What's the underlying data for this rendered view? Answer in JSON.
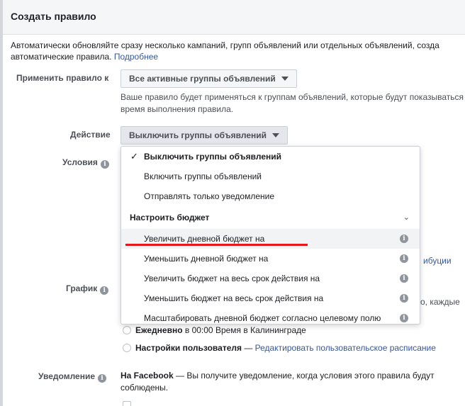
{
  "dialog": {
    "title": "Создать правило",
    "intro_line1": "Автоматически обновляйте сразу несколько кампаний, групп объявлений или отдельных объявлений, созда",
    "intro_line2": "автоматические правила.",
    "intro_link": "Подробнее"
  },
  "apply_rule": {
    "label": "Применить правило к",
    "value": "Все активные группы объявлений",
    "hint_line1": "Ваше правило будет применяться к группам объявлений, которые будут показываться",
    "hint_line2": "время выполнения правила."
  },
  "action": {
    "label": "Действие",
    "value": "Выключить группы объявлений"
  },
  "conditions": {
    "label": "Условия"
  },
  "schedule": {
    "label": "График"
  },
  "notification": {
    "label": "Уведомление",
    "facebook_bold": "На Facebook",
    "facebook_text": " — Вы получите уведомление, когда условия этого правила будут",
    "facebook_text2": "соблюдены."
  },
  "behind": {
    "attribution_fragment": "ибуции",
    "each_fragment": "о, каждые"
  },
  "schedule_options": [
    {
      "bold": "Ежедневно",
      "text": " в 00:00 Время в Калининграде",
      "link": ""
    },
    {
      "bold": "Настройки пользователя",
      "text": " — ",
      "link": "Редактировать пользовательское расписание"
    }
  ],
  "dropdown": {
    "items_top": [
      {
        "label": "Выключить группы объявлений",
        "selected": true
      },
      {
        "label": "Включить группы объявлений",
        "selected": false
      },
      {
        "label": "Отправлять только уведомление",
        "selected": false
      }
    ],
    "section_label": "Настроить бюджет",
    "budget_items": [
      {
        "label": "Увеличить дневной бюджет на",
        "hovered": true
      },
      {
        "label": "Уменьшить дневной бюджет на",
        "hovered": false
      },
      {
        "label": "Увеличить бюджет на весь срок действия на",
        "hovered": false
      },
      {
        "label": "Уменьшить бюджет на весь срок действия на",
        "hovered": false
      },
      {
        "label": "Масштабировать дневной бюджет согласно целевому полю",
        "hovered": false
      }
    ]
  },
  "colors": {
    "link": "#385898",
    "highlight_underline": "#e8151b",
    "header_bg": "#f5f6f7"
  }
}
